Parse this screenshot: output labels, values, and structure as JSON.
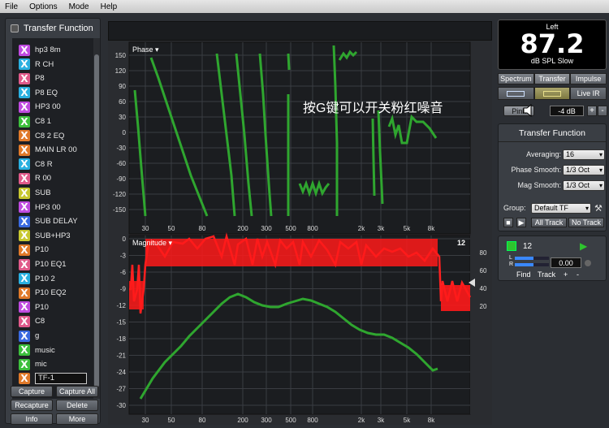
{
  "menu": [
    "File",
    "Options",
    "Mode",
    "Help"
  ],
  "left_panel": {
    "title": "Transfer Function",
    "items": [
      {
        "label": "hp3 8m",
        "color": "#c04be0"
      },
      {
        "label": "R CH",
        "color": "#2ab0e0"
      },
      {
        "label": "P8",
        "color": "#e05a8a"
      },
      {
        "label": "P8 EQ",
        "color": "#2ab0e0"
      },
      {
        "label": "HP3 00",
        "color": "#c04be0"
      },
      {
        "label": "C8  1",
        "color": "#3dbf3d"
      },
      {
        "label": "C8 2 EQ",
        "color": "#e07a2a"
      },
      {
        "label": "MAIN LR 00",
        "color": "#e07a2a"
      },
      {
        "label": "C8 R",
        "color": "#2ab0e0"
      },
      {
        "label": "R 00",
        "color": "#e05a8a"
      },
      {
        "label": "SUB",
        "color": "#c8c830"
      },
      {
        "label": "HP3 00",
        "color": "#c04be0"
      },
      {
        "label": "SUB DELAY",
        "color": "#3a6ae0"
      },
      {
        "label": "SUB+HP3",
        "color": "#c8c830"
      },
      {
        "label": "P10",
        "color": "#e07a2a"
      },
      {
        "label": "P10 EQ1",
        "color": "#e05a8a"
      },
      {
        "label": "P10 2",
        "color": "#2ab0e0"
      },
      {
        "label": "P10 EQ2",
        "color": "#e07a2a"
      },
      {
        "label": "P10",
        "color": "#c04be0"
      },
      {
        "label": "C8",
        "color": "#e05a8a"
      },
      {
        "label": "g",
        "color": "#3a6ae0"
      },
      {
        "label": "music",
        "color": "#3dbf3d"
      },
      {
        "label": "mic",
        "color": "#3dbf3d"
      },
      {
        "label": "TF-1",
        "color": "#e07a2a"
      }
    ],
    "buttons": [
      "Capture",
      "Capture All",
      "Recapture",
      "Delete",
      "Info",
      "More"
    ]
  },
  "phase_graph": {
    "label": "Phase ▾",
    "y_ticks": [
      "150",
      "120",
      "90",
      "60",
      "30",
      "0",
      "-30",
      "-60",
      "-90",
      "-120",
      "-150"
    ],
    "x_ticks": [
      "30",
      "50",
      "80",
      "200",
      "300",
      "500",
      "800",
      "2k",
      "3k",
      "5k",
      "8k"
    ]
  },
  "magnitude_graph": {
    "label": "Magnitude ▾",
    "y_ticks": [
      "0",
      "-3",
      "-6",
      "-9",
      "-12",
      "-15",
      "-18",
      "-21",
      "-24",
      "-27",
      "-30"
    ],
    "right_ticks": [
      "80",
      "60",
      "40",
      "20"
    ],
    "badge": "12",
    "x_ticks": [
      "30",
      "50",
      "80",
      "200",
      "300",
      "500",
      "800",
      "2k",
      "3k",
      "5k",
      "8k"
    ]
  },
  "overlay_text": "按G键可以开关粉红噪音",
  "spl_meter": {
    "channel": "Left",
    "value": "87.2",
    "unit": "dB SPL Slow"
  },
  "view_tabs": [
    "Spectrum",
    "Transfer",
    "Impulse"
  ],
  "live_ir": "Live IR",
  "pink": {
    "label": "Pink",
    "level": "-4 dB",
    "plus": "+",
    "minus": "-"
  },
  "tf_panel": {
    "title": "Transfer Function",
    "averaging": {
      "label": "Averaging:",
      "value": "16"
    },
    "phase_smooth": {
      "label": "Phase Smooth:",
      "value": "1/3 Oct"
    },
    "mag_smooth": {
      "label": "Mag Smooth:",
      "value": "1/3 Oct"
    },
    "group": {
      "label": "Group:",
      "value": "Default TF"
    },
    "all_track": "All Track",
    "no_track": "No Track"
  },
  "track": {
    "number": "12",
    "L": "L",
    "R": "R",
    "value": "0.00",
    "find": "Find",
    "track": "Track",
    "plus": "+",
    "minus": "-"
  }
}
